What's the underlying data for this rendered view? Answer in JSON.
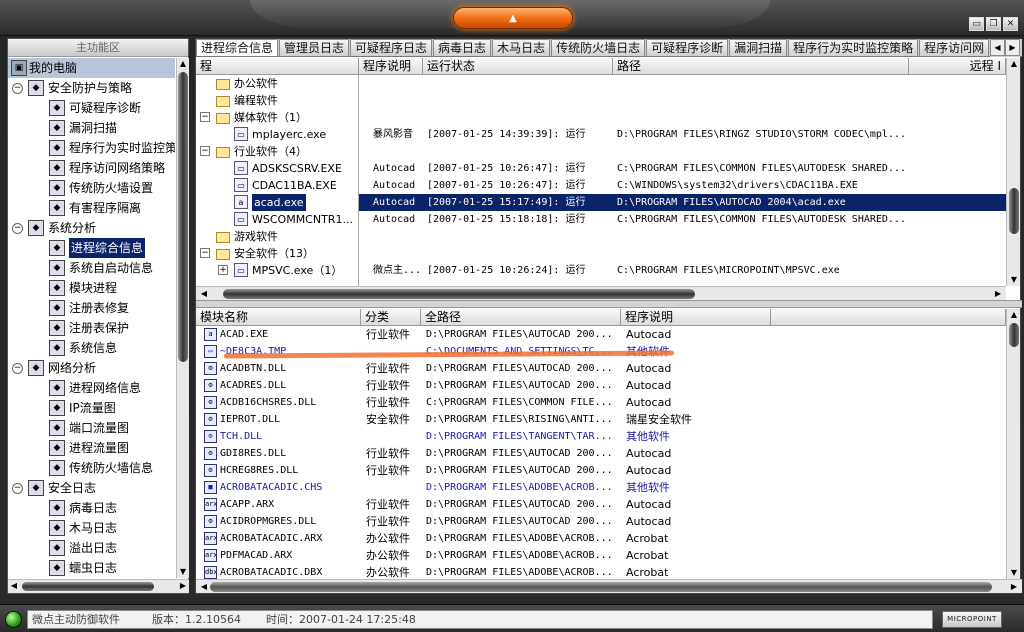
{
  "window": {
    "menu_button_label": "▲",
    "controls": [
      "▭",
      "❐",
      "✕"
    ]
  },
  "sidebar": {
    "title": "主功能区",
    "root": "我的电脑",
    "items": [
      {
        "label": "安全防护与策略",
        "level": 0,
        "icon": "shield-icon"
      },
      {
        "label": "可疑程序诊断",
        "level": 1,
        "icon": "diagnose-icon"
      },
      {
        "label": "漏洞扫描",
        "level": 1,
        "icon": "magnifier-icon"
      },
      {
        "label": "程序行为实时监控策略",
        "level": 1,
        "icon": "monitor-icon"
      },
      {
        "label": "程序访问网络策略",
        "level": 1,
        "icon": "network-policy-icon"
      },
      {
        "label": "传统防火墙设置",
        "level": 1,
        "icon": "firewall-icon"
      },
      {
        "label": "有害程序隔离",
        "level": 1,
        "icon": "quarantine-icon"
      },
      {
        "label": "系统分析",
        "level": 0,
        "icon": "system-icon"
      },
      {
        "label": "进程综合信息",
        "level": 1,
        "icon": "process-info-icon",
        "selected": true
      },
      {
        "label": "系统自启动信息",
        "level": 1,
        "icon": "startup-icon"
      },
      {
        "label": "模块进程",
        "level": 1,
        "icon": "module-icon"
      },
      {
        "label": "注册表修复",
        "level": 1,
        "icon": "registry-repair-icon"
      },
      {
        "label": "注册表保护",
        "level": 1,
        "icon": "registry-protect-icon"
      },
      {
        "label": "系统信息",
        "level": 1,
        "icon": "system-info-icon"
      },
      {
        "label": "网络分析",
        "level": 0,
        "icon": "network-icon"
      },
      {
        "label": "进程网络信息",
        "level": 1,
        "icon": "process-network-icon"
      },
      {
        "label": "IP流量图",
        "level": 1,
        "icon": "ip-traffic-icon"
      },
      {
        "label": "端口流量图",
        "level": 1,
        "icon": "port-traffic-icon"
      },
      {
        "label": "进程流量图",
        "level": 1,
        "icon": "process-traffic-icon"
      },
      {
        "label": "传统防火墙信息",
        "level": 1,
        "icon": "firewall-info-icon"
      },
      {
        "label": "安全日志",
        "level": 0,
        "icon": "log-icon"
      },
      {
        "label": "病毒日志",
        "level": 1,
        "icon": "virus-log-icon"
      },
      {
        "label": "木马日志",
        "level": 1,
        "icon": "trojan-log-icon"
      },
      {
        "label": "溢出日志",
        "level": 1,
        "icon": "overflow-log-icon"
      },
      {
        "label": "蠕虫日志",
        "level": 1,
        "icon": "worm-log-icon"
      }
    ]
  },
  "tabs": [
    {
      "label": "进程综合信息",
      "active": true
    },
    {
      "label": "管理员日志"
    },
    {
      "label": "可疑程序日志"
    },
    {
      "label": "病毒日志"
    },
    {
      "label": "木马日志"
    },
    {
      "label": "传统防火墙日志"
    },
    {
      "label": "可疑程序诊断"
    },
    {
      "label": "漏洞扫描"
    },
    {
      "label": "程序行为实时监控策略"
    },
    {
      "label": "程序访问网"
    }
  ],
  "process_table": {
    "columns": [
      "程",
      "程序说明",
      "运行状态",
      "路径",
      "远程 I"
    ],
    "tree": [
      {
        "label": "办公软件",
        "type": "folder",
        "indent": 1
      },
      {
        "label": "编程软件",
        "type": "folder",
        "indent": 1
      },
      {
        "label": "媒体软件（1）",
        "type": "folder",
        "indent": 1,
        "expand": "-"
      },
      {
        "label": "mplayerc.exe",
        "type": "exe",
        "indent": 2
      },
      {
        "label": "行业软件（4）",
        "type": "folder",
        "indent": 1,
        "expand": "-"
      },
      {
        "label": "ADSKSCSRV.EXE",
        "type": "exe",
        "indent": 2
      },
      {
        "label": "CDAC11BA.EXE",
        "type": "exe",
        "indent": 2
      },
      {
        "label": "acad.exe",
        "type": "exe",
        "indent": 2,
        "selected": true
      },
      {
        "label": "WSCOMMCNTR1...",
        "type": "exe",
        "indent": 2
      },
      {
        "label": "游戏软件",
        "type": "folder",
        "indent": 1
      },
      {
        "label": "安全软件（13）",
        "type": "folder",
        "indent": 1,
        "expand": "-"
      },
      {
        "label": "MPSVC.exe（1）",
        "type": "exe",
        "indent": 2,
        "expand": "+"
      }
    ],
    "rows": [
      {
        "row": 3,
        "desc": "暴风影音",
        "status": "[2007-01-25 14:39:39]: 运行",
        "path": "D:\\PROGRAM FILES\\RINGZ STUDIO\\STORM CODEC\\mpl..."
      },
      {
        "row": 5,
        "desc": "Autocad",
        "status": "[2007-01-25 10:26:47]: 运行",
        "path": "C:\\PROGRAM FILES\\COMMON FILES\\AUTODESK SHARED..."
      },
      {
        "row": 6,
        "desc": "Autocad",
        "status": "[2007-01-25 10:26:47]: 运行",
        "path": "C:\\WINDOWS\\system32\\drivers\\CDAC11BA.EXE"
      },
      {
        "row": 7,
        "desc": "Autocad",
        "status": "[2007-01-25 15:17:49]: 运行",
        "path": "D:\\PROGRAM FILES\\AUTOCAD 2004\\acad.exe",
        "selected": true
      },
      {
        "row": 8,
        "desc": "Autocad",
        "status": "[2007-01-25 15:18:18]: 运行",
        "path": "C:\\PROGRAM FILES\\COMMON FILES\\AUTODESK SHARED..."
      },
      {
        "row": 11,
        "desc": "微点主...",
        "status": "[2007-01-25 10:26:24]: 运行",
        "path": "C:\\PROGRAM FILES\\MICROPOINT\\MPSVC.exe"
      }
    ]
  },
  "module_table": {
    "columns": [
      "模块名称",
      "分类",
      "全路径",
      "程序说明"
    ],
    "rows": [
      {
        "name": "ACAD.EXE",
        "cat": "行业软件",
        "path": "D:\\PROGRAM FILES\\AUTOCAD 200...",
        "desc": "Autocad",
        "icon": "a"
      },
      {
        "name": "~DE8C3A.TMP",
        "cat": "",
        "path": "C:\\DOCUMENTS AND SETTINGS\\TC...",
        "desc": "其他软件",
        "icon": "▭",
        "other": true
      },
      {
        "name": "ACADBTN.DLL",
        "cat": "行业软件",
        "path": "D:\\PROGRAM FILES\\AUTOCAD 200...",
        "desc": "Autocad",
        "icon": "⚙"
      },
      {
        "name": "ACADRES.DLL",
        "cat": "行业软件",
        "path": "D:\\PROGRAM FILES\\AUTOCAD 200...",
        "desc": "Autocad",
        "icon": "⚙"
      },
      {
        "name": "ACDB16CHSRES.DLL",
        "cat": "行业软件",
        "path": "C:\\PROGRAM FILES\\COMMON FILE...",
        "desc": "Autocad",
        "icon": "⚙"
      },
      {
        "name": "IEPROT.DLL",
        "cat": "安全软件",
        "path": "D:\\PROGRAM FILES\\RISING\\ANTI...",
        "desc": "瑞星安全软件",
        "icon": "⚙"
      },
      {
        "name": "TCH.DLL",
        "cat": "",
        "path": "D:\\PROGRAM FILES\\TANGENT\\TAR...",
        "desc": "其他软件",
        "icon": "⚙",
        "other": true
      },
      {
        "name": "GDI8RES.DLL",
        "cat": "行业软件",
        "path": "D:\\PROGRAM FILES\\AUTOCAD 200...",
        "desc": "Autocad",
        "icon": "⚙"
      },
      {
        "name": "HCREG8RES.DLL",
        "cat": "行业软件",
        "path": "D:\\PROGRAM FILES\\AUTOCAD 200...",
        "desc": "Autocad",
        "icon": "⚙"
      },
      {
        "name": "ACROBATACADIC.CHS",
        "cat": "",
        "path": "D:\\PROGRAM FILES\\ADOBE\\ACROB...",
        "desc": "其他软件",
        "icon": "■",
        "other": true
      },
      {
        "name": "ACAPP.ARX",
        "cat": "行业软件",
        "path": "D:\\PROGRAM FILES\\AUTOCAD 200...",
        "desc": "Autocad",
        "icon": "arx"
      },
      {
        "name": "ACIDROPMGRES.DLL",
        "cat": "行业软件",
        "path": "D:\\PROGRAM FILES\\AUTOCAD 200...",
        "desc": "Autocad",
        "icon": "⚙"
      },
      {
        "name": "ACROBATACADIC.ARX",
        "cat": "办公软件",
        "path": "D:\\PROGRAM FILES\\ADOBE\\ACROB...",
        "desc": "Acrobat",
        "icon": "arx"
      },
      {
        "name": "PDFMACAD.ARX",
        "cat": "办公软件",
        "path": "D:\\PROGRAM FILES\\ADOBE\\ACROB...",
        "desc": "Acrobat",
        "icon": "arx"
      },
      {
        "name": "ACROBATACADIC.DBX",
        "cat": "办公软件",
        "path": "D:\\PROGRAM FILES\\ADOBE\\ACROB...",
        "desc": "Acrobat",
        "icon": "dbx"
      }
    ]
  },
  "status_bar": {
    "app_name": "微点主动防御软件",
    "version": "版本：1.2.10564",
    "time": "时间：2007-01-24 17:25:48",
    "brand": "MICROPOINT"
  }
}
